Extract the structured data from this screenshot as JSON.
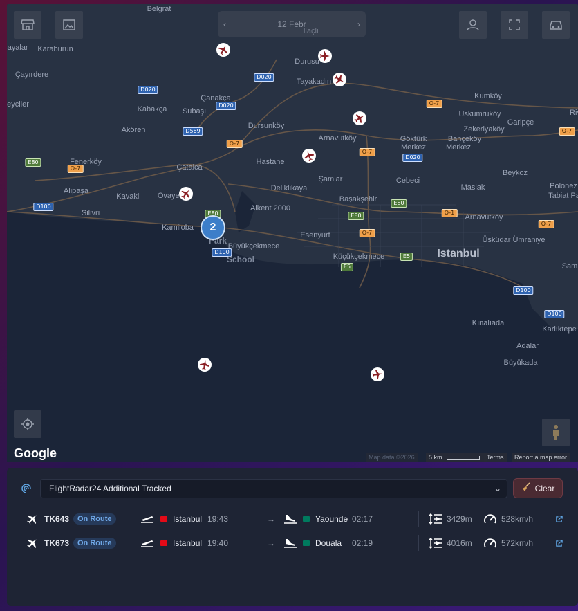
{
  "map": {
    "date_label": "12 Febr",
    "google_logo": "Google",
    "attribution": {
      "map_data": "Map data ©2026",
      "scale": "5 km",
      "terms": "Terms",
      "report": "Report a map error"
    },
    "cluster_count": "2",
    "place_labels": [
      {
        "t": "Belgrat"
      },
      {
        "t": "Karaburun"
      },
      {
        "t": "Sayalar"
      },
      {
        "t": "llaçlı"
      },
      {
        "t": "Durusu"
      },
      {
        "t": "Çayırdere"
      },
      {
        "t": "Tayakadın"
      },
      {
        "t": "Çanakça"
      },
      {
        "t": "Kumköy"
      },
      {
        "t": "eyciler"
      },
      {
        "t": "Kabakça"
      },
      {
        "t": "Subaşı"
      },
      {
        "t": "Uskumruköy"
      },
      {
        "t": "Riv"
      },
      {
        "t": "Garipçe"
      },
      {
        "t": "Dursunköy"
      },
      {
        "t": "Göktürk"
      },
      {
        "t": "Zekeriyaköy"
      },
      {
        "t": "Akören"
      },
      {
        "t": "Arnavutköy"
      },
      {
        "t": "Merkez"
      },
      {
        "t": "Bahçeköy"
      },
      {
        "t": "Merkez"
      },
      {
        "t": "Fenerköy"
      },
      {
        "t": "Hastane"
      },
      {
        "t": "Çatalca"
      },
      {
        "t": "Beykoz"
      },
      {
        "t": "Şamlar"
      },
      {
        "t": "Cebeci"
      },
      {
        "t": "Alipaşa"
      },
      {
        "t": "Deliklikaya"
      },
      {
        "t": "Maslak"
      },
      {
        "t": "Kavakli"
      },
      {
        "t": "Ovayeni"
      },
      {
        "t": "Başakşehir"
      },
      {
        "t": "Polonez"
      },
      {
        "t": "Tabiat Pa"
      },
      {
        "t": "Silivri"
      },
      {
        "t": "Alkent 2000"
      },
      {
        "t": "Arnavutköy"
      },
      {
        "t": "Kamiloba"
      },
      {
        "t": "Esenyurt"
      },
      {
        "t": "Üsküdar Ümraniye"
      },
      {
        "t": "Büyükçekmece"
      },
      {
        "t": "Küçükçekmece"
      },
      {
        "t": "Sam"
      },
      {
        "t": "Kınalıada"
      },
      {
        "t": "Karlıktepe"
      },
      {
        "t": "Adalar"
      },
      {
        "t": "Büyükada"
      }
    ],
    "city_label": "Istanbul",
    "poi_labels": [
      "Park",
      "School"
    ],
    "shields": [
      {
        "t": "D020",
        "c": "blue"
      },
      {
        "t": "D020",
        "c": "blue"
      },
      {
        "t": "D020",
        "c": "blue"
      },
      {
        "t": "O-7",
        "c": "orange"
      },
      {
        "t": "D569",
        "c": "blue"
      },
      {
        "t": "O-7",
        "c": "orange"
      },
      {
        "t": "O-7",
        "c": "orange"
      },
      {
        "t": "O-7",
        "c": "orange"
      },
      {
        "t": "D020",
        "c": "blue"
      },
      {
        "t": "E80",
        "c": "green"
      },
      {
        "t": "O-7",
        "c": "orange"
      },
      {
        "t": "D100",
        "c": "blue"
      },
      {
        "t": "E80",
        "c": "green"
      },
      {
        "t": "E80",
        "c": "green"
      },
      {
        "t": "O-1",
        "c": "orange"
      },
      {
        "t": "E80",
        "c": "green"
      },
      {
        "t": "O-7",
        "c": "orange"
      },
      {
        "t": "D100",
        "c": "blue"
      },
      {
        "t": "E5",
        "c": "green"
      },
      {
        "t": "E5",
        "c": "green"
      },
      {
        "t": "O-7",
        "c": "orange"
      },
      {
        "t": "D100",
        "c": "blue"
      },
      {
        "t": "D100",
        "c": "blue"
      }
    ]
  },
  "panel": {
    "source_select": "FlightRadar24 Additional Tracked",
    "clear_label": "Clear",
    "arrow": "→",
    "flights": [
      {
        "flight": "TK643",
        "status": "On Route",
        "from": "Istanbul",
        "dep": "19:43",
        "to": "Yaounde",
        "arr": "02:17",
        "alt": "3429m",
        "speed": "528km/h",
        "from_flag": "#e30a17",
        "to_flag": "#007a5e"
      },
      {
        "flight": "TK673",
        "status": "On Route",
        "from": "Istanbul",
        "dep": "19:40",
        "to": "Douala",
        "arr": "02:19",
        "alt": "4016m",
        "speed": "572km/h",
        "from_flag": "#e30a17",
        "to_flag": "#007a5e"
      }
    ]
  }
}
